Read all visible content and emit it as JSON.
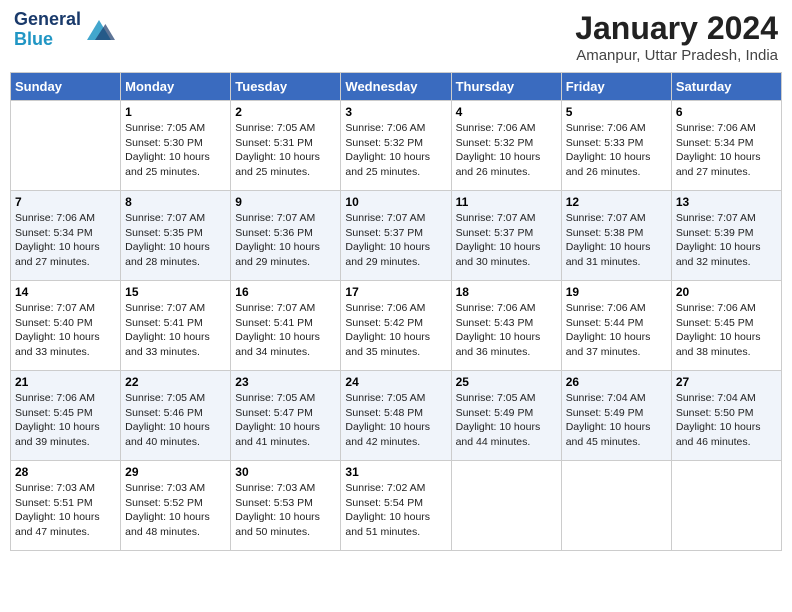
{
  "header": {
    "logo_line1": "General",
    "logo_line2": "Blue",
    "month": "January 2024",
    "location": "Amanpur, Uttar Pradesh, India"
  },
  "days_of_week": [
    "Sunday",
    "Monday",
    "Tuesday",
    "Wednesday",
    "Thursday",
    "Friday",
    "Saturday"
  ],
  "weeks": [
    [
      {
        "num": "",
        "sunrise": "",
        "sunset": "",
        "daylight": ""
      },
      {
        "num": "1",
        "sunrise": "7:05 AM",
        "sunset": "5:30 PM",
        "daylight": "10 hours and 25 minutes."
      },
      {
        "num": "2",
        "sunrise": "7:05 AM",
        "sunset": "5:31 PM",
        "daylight": "10 hours and 25 minutes."
      },
      {
        "num": "3",
        "sunrise": "7:06 AM",
        "sunset": "5:32 PM",
        "daylight": "10 hours and 25 minutes."
      },
      {
        "num": "4",
        "sunrise": "7:06 AM",
        "sunset": "5:32 PM",
        "daylight": "10 hours and 26 minutes."
      },
      {
        "num": "5",
        "sunrise": "7:06 AM",
        "sunset": "5:33 PM",
        "daylight": "10 hours and 26 minutes."
      },
      {
        "num": "6",
        "sunrise": "7:06 AM",
        "sunset": "5:34 PM",
        "daylight": "10 hours and 27 minutes."
      }
    ],
    [
      {
        "num": "7",
        "sunrise": "7:06 AM",
        "sunset": "5:34 PM",
        "daylight": "10 hours and 27 minutes."
      },
      {
        "num": "8",
        "sunrise": "7:07 AM",
        "sunset": "5:35 PM",
        "daylight": "10 hours and 28 minutes."
      },
      {
        "num": "9",
        "sunrise": "7:07 AM",
        "sunset": "5:36 PM",
        "daylight": "10 hours and 29 minutes."
      },
      {
        "num": "10",
        "sunrise": "7:07 AM",
        "sunset": "5:37 PM",
        "daylight": "10 hours and 29 minutes."
      },
      {
        "num": "11",
        "sunrise": "7:07 AM",
        "sunset": "5:37 PM",
        "daylight": "10 hours and 30 minutes."
      },
      {
        "num": "12",
        "sunrise": "7:07 AM",
        "sunset": "5:38 PM",
        "daylight": "10 hours and 31 minutes."
      },
      {
        "num": "13",
        "sunrise": "7:07 AM",
        "sunset": "5:39 PM",
        "daylight": "10 hours and 32 minutes."
      }
    ],
    [
      {
        "num": "14",
        "sunrise": "7:07 AM",
        "sunset": "5:40 PM",
        "daylight": "10 hours and 33 minutes."
      },
      {
        "num": "15",
        "sunrise": "7:07 AM",
        "sunset": "5:41 PM",
        "daylight": "10 hours and 33 minutes."
      },
      {
        "num": "16",
        "sunrise": "7:07 AM",
        "sunset": "5:41 PM",
        "daylight": "10 hours and 34 minutes."
      },
      {
        "num": "17",
        "sunrise": "7:06 AM",
        "sunset": "5:42 PM",
        "daylight": "10 hours and 35 minutes."
      },
      {
        "num": "18",
        "sunrise": "7:06 AM",
        "sunset": "5:43 PM",
        "daylight": "10 hours and 36 minutes."
      },
      {
        "num": "19",
        "sunrise": "7:06 AM",
        "sunset": "5:44 PM",
        "daylight": "10 hours and 37 minutes."
      },
      {
        "num": "20",
        "sunrise": "7:06 AM",
        "sunset": "5:45 PM",
        "daylight": "10 hours and 38 minutes."
      }
    ],
    [
      {
        "num": "21",
        "sunrise": "7:06 AM",
        "sunset": "5:45 PM",
        "daylight": "10 hours and 39 minutes."
      },
      {
        "num": "22",
        "sunrise": "7:05 AM",
        "sunset": "5:46 PM",
        "daylight": "10 hours and 40 minutes."
      },
      {
        "num": "23",
        "sunrise": "7:05 AM",
        "sunset": "5:47 PM",
        "daylight": "10 hours and 41 minutes."
      },
      {
        "num": "24",
        "sunrise": "7:05 AM",
        "sunset": "5:48 PM",
        "daylight": "10 hours and 42 minutes."
      },
      {
        "num": "25",
        "sunrise": "7:05 AM",
        "sunset": "5:49 PM",
        "daylight": "10 hours and 44 minutes."
      },
      {
        "num": "26",
        "sunrise": "7:04 AM",
        "sunset": "5:49 PM",
        "daylight": "10 hours and 45 minutes."
      },
      {
        "num": "27",
        "sunrise": "7:04 AM",
        "sunset": "5:50 PM",
        "daylight": "10 hours and 46 minutes."
      }
    ],
    [
      {
        "num": "28",
        "sunrise": "7:03 AM",
        "sunset": "5:51 PM",
        "daylight": "10 hours and 47 minutes."
      },
      {
        "num": "29",
        "sunrise": "7:03 AM",
        "sunset": "5:52 PM",
        "daylight": "10 hours and 48 minutes."
      },
      {
        "num": "30",
        "sunrise": "7:03 AM",
        "sunset": "5:53 PM",
        "daylight": "10 hours and 50 minutes."
      },
      {
        "num": "31",
        "sunrise": "7:02 AM",
        "sunset": "5:54 PM",
        "daylight": "10 hours and 51 minutes."
      },
      {
        "num": "",
        "sunrise": "",
        "sunset": "",
        "daylight": ""
      },
      {
        "num": "",
        "sunrise": "",
        "sunset": "",
        "daylight": ""
      },
      {
        "num": "",
        "sunrise": "",
        "sunset": "",
        "daylight": ""
      }
    ]
  ],
  "labels": {
    "sunrise": "Sunrise:",
    "sunset": "Sunset:",
    "daylight": "Daylight:"
  }
}
